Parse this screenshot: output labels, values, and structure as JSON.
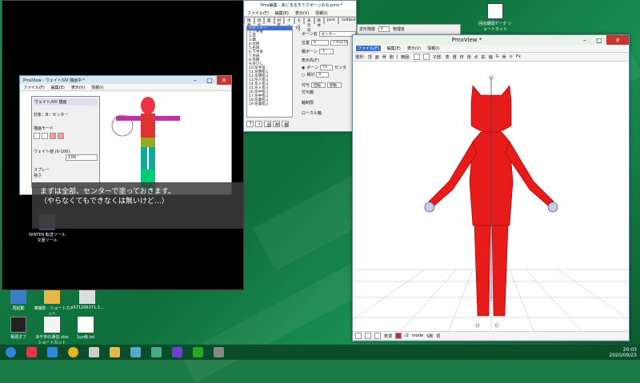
{
  "desktop": {
    "icons": [
      {
        "label": "回収期間データ ショートカット"
      },
      {
        "label": "再起動"
      },
      {
        "label": "壊撮影 - ショートカット"
      },
      {
        "label": "p571206371.1..."
      },
      {
        "label": "電源オフ"
      },
      {
        "label": "あや市の通信.xlsx ショートカット"
      },
      {
        "label": "1yo様.txt"
      }
    ],
    "icon_under_left": "NINTEN 転送ツール 文書ツール"
  },
  "pmx_editor": {
    "title": "Pmx編集 - あにまるきミクボーンのみ.pmx *",
    "menu": [
      "ファイル(F)",
      "編集(E)",
      "表示(V)",
      "情報(I)"
    ],
    "tabs": [
      "情報",
      "頂点",
      "面",
      "材質",
      "ボーン",
      "モーフ",
      "表示枠",
      "剛体",
      "Joint",
      "SoftBody"
    ],
    "active_tab": "ボーン",
    "bone_name_label": "ボーン名",
    "bone_name_value": "センター",
    "position_label": "位置",
    "position_value": "0",
    "position_x": "7.93275",
    "parent_label": "親ボーン",
    "parent_value": "-1",
    "display_label": "表示先(F)",
    "radio_bone": "ボーン",
    "radio_bone_value": "71",
    "radio_bone_suffix": "センタ",
    "radio_offset": "相対",
    "radio_offset_value": "0",
    "count_top": "77",
    "bone_list": [
      "0:センター",
      "1:上半身",
      "2:首",
      "3:頭",
      "4:左目",
      "5:右目",
      "6:下半身",
      "7:左肩",
      "8:左腕",
      "9:左ひじ",
      "10:左手首",
      "11:左親指１",
      "12:左親指２",
      "13:左人指１",
      "14:左人指２",
      "15:左人指３",
      "16:左中指１",
      "17:左中指２",
      "18:左薬指１",
      "19:左薬指２"
    ],
    "grant_label": "付与",
    "grant_rotate": "回転",
    "grant_move": "移動",
    "grant_parent": "付与親",
    "axis_fixed": "軸制限",
    "local_axis": "ローカル軸",
    "deform_layer": "変形階層",
    "deform_value": "0",
    "physics_after": "物理後",
    "bottom_buttons": [
      "↑",
      "↓",
      "追",
      "削",
      "複"
    ]
  },
  "weight_window": {
    "title": "PmxView - ウェイト/UV 描画中 *",
    "menu": [
      "ファイル(F)",
      "編集(E)",
      "表示(V)",
      "情報(I)"
    ],
    "panel_title": "ウェイト/UV 描画",
    "target_label": "対象：B：センター",
    "mode_label": "描画モード",
    "weight_label": "ウェイト値 (0-100)",
    "weight_value": "100",
    "spray": "スプレー",
    "strength": "強さ"
  },
  "pmx_view": {
    "title": "PmxView *",
    "menu": [
      "ファイル(F)",
      "編集(E)",
      "表示(V)",
      "情報(I)"
    ],
    "toolbar_labels": [
      "選択:",
      "頂",
      "面",
      "骨",
      "剛",
      "J",
      "範囲:",
      "子部:",
      "表",
      "選",
      "材",
      "視",
      "点",
      "拡",
      "縮",
      "G",
      "骨",
      "Fx"
    ],
    "bottom_labels": [
      "表頂",
      "/2",
      "mode",
      "S刷",
      "頂"
    ]
  },
  "subtitle": {
    "line1": "まずは全部、センターで塗っておきます。",
    "line2": "（やらなくてもできなくは無いけど…）"
  },
  "taskbar": {
    "time": "20:03",
    "date": "2020/09/23"
  }
}
